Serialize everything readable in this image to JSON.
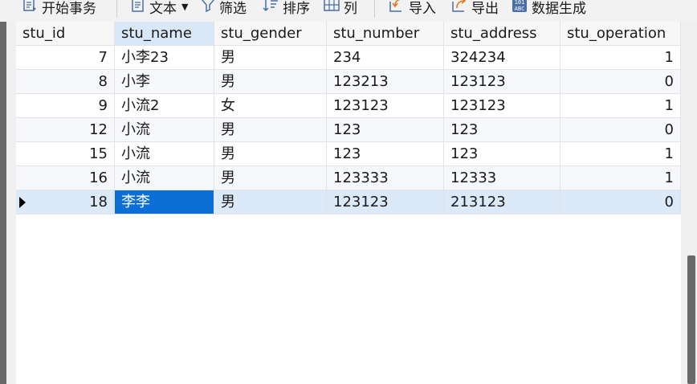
{
  "toolbar": {
    "begin_transaction": "开始事务",
    "text": "文本",
    "filter": "筛选",
    "sort": "排序",
    "columns": "列",
    "import": "导入",
    "export": "导出",
    "data_generate": "数据生成"
  },
  "table": {
    "columns": [
      "stu_id",
      "stu_name",
      "stu_gender",
      "stu_number",
      "stu_address",
      "stu_operation"
    ],
    "rows": [
      [
        "7",
        "小李23",
        "男",
        "234",
        "324234",
        "1"
      ],
      [
        "8",
        "小李",
        "男",
        "123213",
        "123123",
        "0"
      ],
      [
        "9",
        "小流2",
        "女",
        "123123",
        "123123",
        "1"
      ],
      [
        "12",
        "小流",
        "男",
        "123",
        "123",
        "0"
      ],
      [
        "15",
        "小流",
        "男",
        "123",
        "123",
        "1"
      ],
      [
        "16",
        "小流",
        "男",
        "123333",
        "12333",
        "1"
      ],
      [
        "18",
        "李李",
        "男",
        "123123",
        "213123",
        "0"
      ]
    ]
  },
  "colors": {
    "selection": "#0b6fd6",
    "selected_row": "#dbe9f9",
    "header_active": "#d9e8f8"
  },
  "icons": [
    "transaction-icon",
    "text-icon",
    "filter-icon",
    "sort-icon",
    "columns-icon",
    "import-icon",
    "export-icon",
    "data-generate-icon"
  ]
}
